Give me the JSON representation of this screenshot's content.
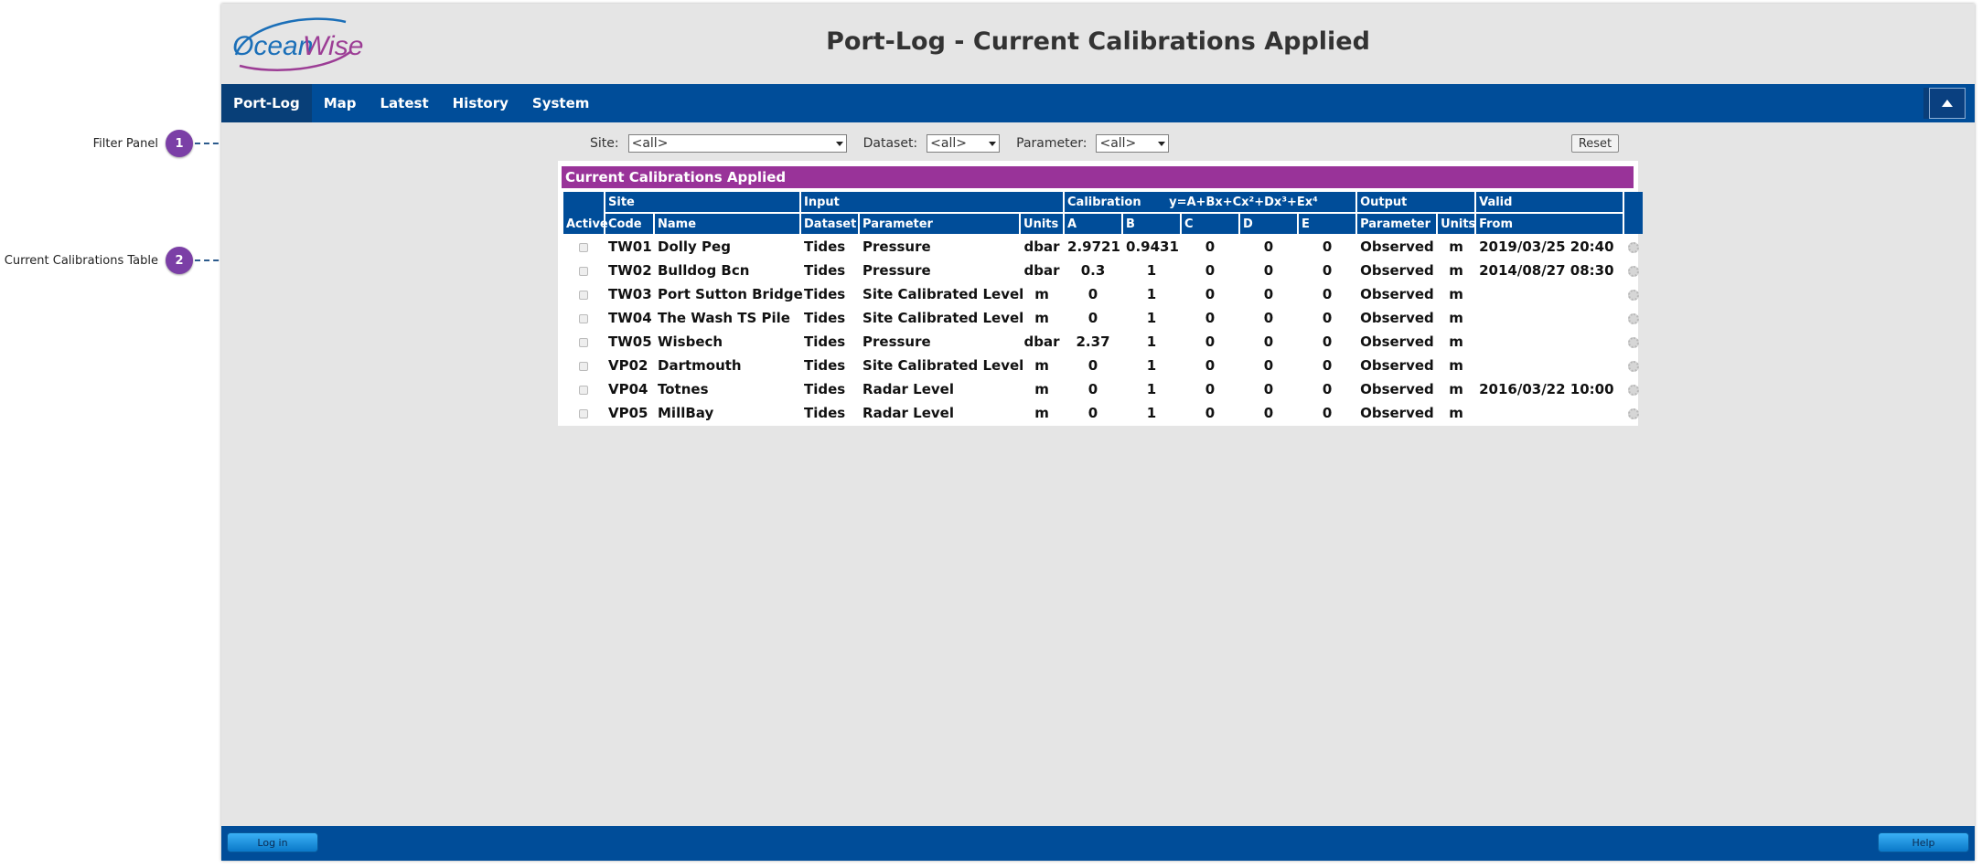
{
  "callouts": [
    {
      "label": "Filter Panel",
      "number": "1"
    },
    {
      "label": "Current Calibrations Table",
      "number": "2"
    }
  ],
  "app": {
    "logo_text": "OceanWise",
    "title": "Port-Log - Current Calibrations Applied"
  },
  "nav": {
    "items": [
      "Port-Log",
      "Map",
      "Latest",
      "History",
      "System"
    ],
    "active": "Port-Log"
  },
  "filter": {
    "site_label": "Site:",
    "site_value": "<all>",
    "dataset_label": "Dataset:",
    "dataset_value": "<all>",
    "parameter_label": "Parameter:",
    "parameter_value": "<all>",
    "reset_label": "Reset"
  },
  "table": {
    "title": "Current Calibrations Applied",
    "group_headers": {
      "site": "Site",
      "input": "Input",
      "calibration": "Calibration",
      "equation": "y=A+Bx+Cx²+Dx³+Ex⁴",
      "output": "Output",
      "valid": "Valid"
    },
    "columns": [
      "Active",
      "Code",
      "Name",
      "Dataset",
      "Parameter",
      "Units",
      "A",
      "B",
      "C",
      "D",
      "E",
      "Parameter",
      "Units",
      "From"
    ],
    "rows": [
      {
        "code": "TW01",
        "name": "Dolly Peg",
        "dataset": "Tides",
        "parameter": "Pressure",
        "units": "dbar",
        "a": "2.9721",
        "b": "0.9431",
        "c": "0",
        "d": "0",
        "e": "0",
        "out_parameter": "Observed",
        "out_units": "m",
        "from": "2019/03/25 20:40"
      },
      {
        "code": "TW02",
        "name": "Bulldog Bcn",
        "dataset": "Tides",
        "parameter": "Pressure",
        "units": "dbar",
        "a": "0.3",
        "b": "1",
        "c": "0",
        "d": "0",
        "e": "0",
        "out_parameter": "Observed",
        "out_units": "m",
        "from": "2014/08/27 08:30"
      },
      {
        "code": "TW03",
        "name": "Port Sutton Bridge",
        "dataset": "Tides",
        "parameter": "Site Calibrated Level",
        "units": "m",
        "a": "0",
        "b": "1",
        "c": "0",
        "d": "0",
        "e": "0",
        "out_parameter": "Observed",
        "out_units": "m",
        "from": ""
      },
      {
        "code": "TW04",
        "name": "The Wash TS Pile",
        "dataset": "Tides",
        "parameter": "Site Calibrated Level",
        "units": "m",
        "a": "0",
        "b": "1",
        "c": "0",
        "d": "0",
        "e": "0",
        "out_parameter": "Observed",
        "out_units": "m",
        "from": ""
      },
      {
        "code": "TW05",
        "name": "Wisbech",
        "dataset": "Tides",
        "parameter": "Pressure",
        "units": "dbar",
        "a": "2.37",
        "b": "1",
        "c": "0",
        "d": "0",
        "e": "0",
        "out_parameter": "Observed",
        "out_units": "m",
        "from": ""
      },
      {
        "code": "VP02",
        "name": "Dartmouth",
        "dataset": "Tides",
        "parameter": "Site Calibrated Level",
        "units": "m",
        "a": "0",
        "b": "1",
        "c": "0",
        "d": "0",
        "e": "0",
        "out_parameter": "Observed",
        "out_units": "m",
        "from": ""
      },
      {
        "code": "VP04",
        "name": "Totnes",
        "dataset": "Tides",
        "parameter": "Radar Level",
        "units": "m",
        "a": "0",
        "b": "1",
        "c": "0",
        "d": "0",
        "e": "0",
        "out_parameter": "Observed",
        "out_units": "m",
        "from": "2016/03/22 10:00"
      },
      {
        "code": "VP05",
        "name": "MillBay",
        "dataset": "Tides",
        "parameter": "Radar Level",
        "units": "m",
        "a": "0",
        "b": "1",
        "c": "0",
        "d": "0",
        "e": "0",
        "out_parameter": "Observed",
        "out_units": "m",
        "from": ""
      }
    ]
  },
  "footer": {
    "login_label": "Log in",
    "help_label": "Help"
  },
  "colors": {
    "nav_blue": "#004d99",
    "title_bar_purple": "#993399",
    "callout_purple": "#7b3fa6"
  },
  "icons": [
    "collapse-up-icon",
    "settings-gear-icon",
    "active-checkbox"
  ]
}
